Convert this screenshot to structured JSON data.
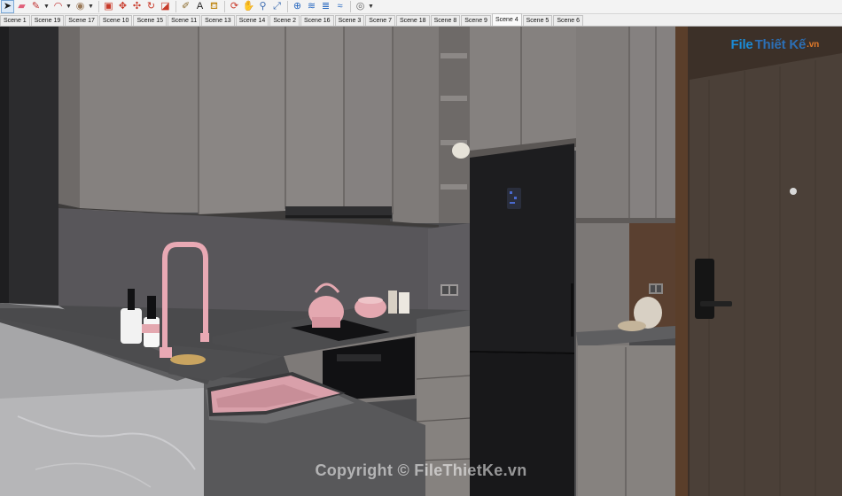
{
  "toolbar": {
    "tools": [
      {
        "icon": "select-arrow-icon",
        "glyph": "➤",
        "color": "#1a1a1a",
        "active": true
      },
      {
        "icon": "eraser-icon",
        "glyph": "▰",
        "color": "#e0607a"
      },
      {
        "icon": "pencil-icon",
        "glyph": "✎",
        "color": "#c03030",
        "dropdown": true
      },
      {
        "icon": "arc-icon",
        "glyph": "◠",
        "color": "#c03030",
        "dropdown": true
      },
      {
        "icon": "shapes-icon",
        "glyph": "◉",
        "color": "#9a7a5a",
        "dropdown": true
      },
      {
        "sep": true
      },
      {
        "icon": "push-pull-icon",
        "glyph": "▣",
        "color": "#c83a2a"
      },
      {
        "icon": "move-icon",
        "glyph": "✥",
        "color": "#c83a2a"
      },
      {
        "icon": "rotate-icon",
        "glyph": "✣",
        "color": "#c83a2a"
      },
      {
        "icon": "follow-me-icon",
        "glyph": "↻",
        "color": "#c83a2a"
      },
      {
        "icon": "scale-icon",
        "glyph": "◪",
        "color": "#c83a2a"
      },
      {
        "sep": true
      },
      {
        "icon": "tape-measure-icon",
        "glyph": "✐",
        "color": "#8a6a2a"
      },
      {
        "icon": "text-icon",
        "glyph": "A",
        "color": "#222"
      },
      {
        "icon": "paint-bucket-icon",
        "glyph": "⛾",
        "color": "#c08a1a"
      },
      {
        "sep": true
      },
      {
        "icon": "orbit-icon",
        "glyph": "⟳",
        "color": "#c83a2a"
      },
      {
        "icon": "pan-icon",
        "glyph": "✋",
        "color": "#c08a1a"
      },
      {
        "icon": "zoom-icon",
        "glyph": "⚲",
        "color": "#3a6ab0"
      },
      {
        "icon": "zoom-extents-icon",
        "glyph": "⤢",
        "color": "#3a6ab0"
      },
      {
        "sep": true
      },
      {
        "icon": "search-warehouse-icon",
        "glyph": "⊕",
        "color": "#2a6ac0"
      },
      {
        "icon": "extension-icon",
        "glyph": "≋",
        "color": "#2a6ac0"
      },
      {
        "icon": "layers-icon",
        "glyph": "≣",
        "color": "#2a6ac0"
      },
      {
        "icon": "sandbox-icon",
        "glyph": "≈",
        "color": "#2a6ac0"
      },
      {
        "sep": true
      },
      {
        "icon": "account-icon",
        "glyph": "◎",
        "color": "#666",
        "dropdown": true
      }
    ]
  },
  "scenes": {
    "tabs": [
      "Scene 1",
      "Scene 19",
      "Scene 17",
      "Scene 10",
      "Scene 15",
      "Scene 11",
      "Scene 13",
      "Scene 14",
      "Scene 2",
      "Scene 16",
      "Scene 3",
      "Scene 7",
      "Scene 18",
      "Scene 8",
      "Scene 9",
      "Scene 4",
      "Scene 5",
      "Scene 6"
    ],
    "active_index": 15
  },
  "viewport": {
    "logo": {
      "part1": "File",
      "part2": "Thiết Kế",
      "part3": ".vn"
    },
    "watermark": "Copyright © FileThietKe.vn",
    "colors": {
      "cabinet": "#807c7a",
      "cabinet_dark": "#6a6664",
      "backsplash": "#5a585c",
      "countertop": "#4e4e50",
      "marble": "#b4b4b6",
      "fridge": "#1c1c1e",
      "door": "#4a3e36",
      "wood": "#5a4030",
      "sink": "#d9a0aa",
      "kettle": "#e4a8b0"
    }
  }
}
